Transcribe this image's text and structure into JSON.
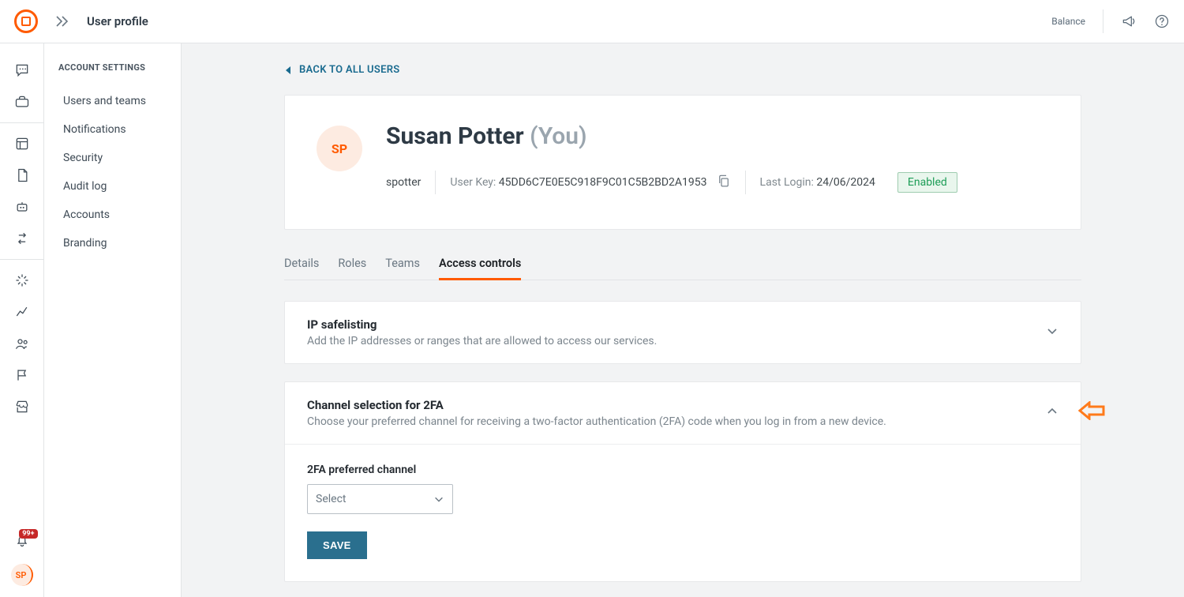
{
  "topbar": {
    "page_title": "User profile",
    "balance_label": "Balance"
  },
  "rail": {
    "notification_badge": "99+",
    "avatar_initials": "SP"
  },
  "sidebar": {
    "header": "ACCOUNT SETTINGS",
    "items": [
      {
        "label": "Users and teams"
      },
      {
        "label": "Notifications"
      },
      {
        "label": "Security"
      },
      {
        "label": "Audit log"
      },
      {
        "label": "Accounts"
      },
      {
        "label": "Branding"
      }
    ]
  },
  "back_link": "BACK TO ALL USERS",
  "user": {
    "initials": "SP",
    "name": "Susan Potter",
    "you_suffix": "(You)",
    "username": "spotter",
    "userkey_label": "User Key:",
    "userkey": "45DD6C7E0E5C918F9C01C5B2BD2A1953",
    "lastlogin_label": "Last Login:",
    "lastlogin": "24/06/2024",
    "status": "Enabled"
  },
  "tabs": [
    {
      "label": "Details"
    },
    {
      "label": "Roles"
    },
    {
      "label": "Teams"
    },
    {
      "label": "Access controls"
    }
  ],
  "panels": {
    "ip": {
      "title": "IP safelisting",
      "sub": "Add the IP addresses or ranges that are allowed to access our services."
    },
    "twofa": {
      "title": "Channel selection for 2FA",
      "sub": "Choose your preferred channel for receiving a two-factor authentication (2FA) code when you log in from a new device.",
      "field_label": "2FA preferred channel",
      "select_placeholder": "Select",
      "save_label": "SAVE"
    }
  }
}
